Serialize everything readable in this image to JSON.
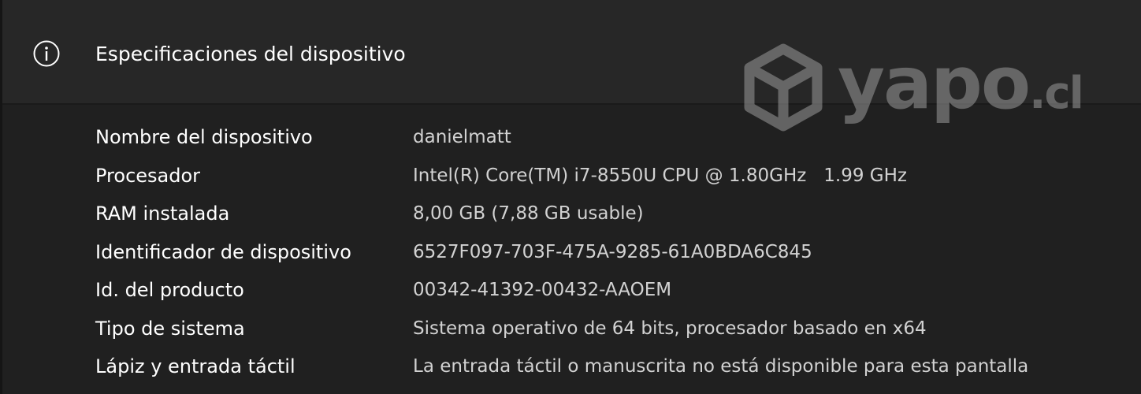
{
  "header": {
    "icon": "info-icon",
    "title": "Especificaciones del dispositivo"
  },
  "watermark": {
    "logo_icon": "box-icon",
    "brand": "yapo",
    "tld": ".cl"
  },
  "specs": [
    {
      "label": "Nombre del dispositivo",
      "value": "danielmatt"
    },
    {
      "label": "Procesador",
      "value": "Intel(R) Core(TM) i7-8550U CPU @ 1.80GHz   1.99 GHz"
    },
    {
      "label": "RAM instalada",
      "value": "8,00 GB (7,88 GB usable)"
    },
    {
      "label": "Identificador de dispositivo",
      "value": "6527F097-703F-475A-9285-61A0BDA6C845"
    },
    {
      "label": "Id. del producto",
      "value": "00342-41392-00432-AAOEM"
    },
    {
      "label": "Tipo de sistema",
      "value": "Sistema operativo de 64 bits, procesador basado en x64"
    },
    {
      "label": "Lápiz y entrada táctil",
      "value": "La entrada táctil o manuscrita no está disponible para esta pantalla"
    }
  ]
}
